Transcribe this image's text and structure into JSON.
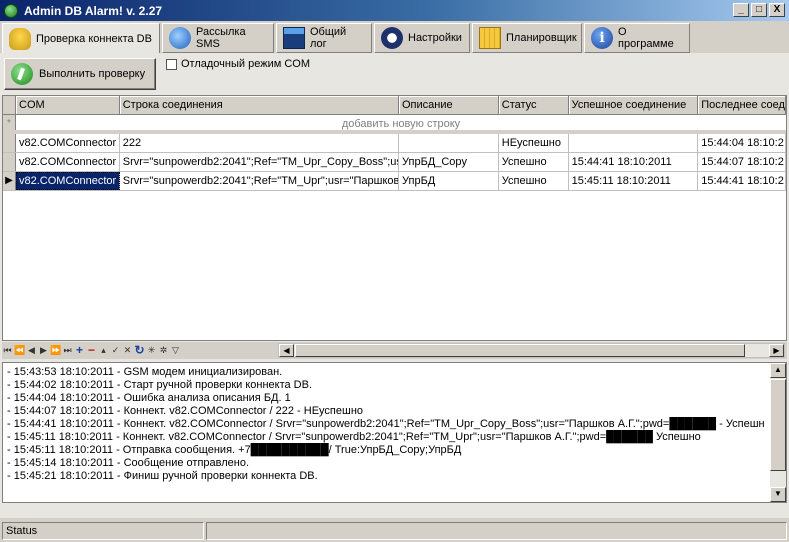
{
  "window": {
    "title": "Admin DB Alarm! v. 2.27",
    "buttons": [
      "_",
      "□",
      "X"
    ]
  },
  "tabs": [
    {
      "label": "Проверка коннекта DB",
      "icon": "bell-icon",
      "active": true
    },
    {
      "label": "Рассылка SMS",
      "icon": "globe-icon",
      "active": false
    },
    {
      "label": "Общий лог",
      "icon": "log-icon",
      "active": false
    },
    {
      "label": "Настройки",
      "icon": "settings-icon",
      "active": false
    },
    {
      "label": "Планировщик",
      "icon": "calendar-icon",
      "active": false
    },
    {
      "label": "О программе",
      "icon": "info-icon",
      "active": false
    }
  ],
  "toolbar": {
    "run_label": "Выполнить проверку",
    "debug_label": "Отладочный режим COM",
    "debug_checked": false
  },
  "grid": {
    "columns": [
      "COM",
      "Строка соединения",
      "Описание",
      "Статус",
      "Успешное соединение",
      "Последнее соед"
    ],
    "new_row_label": "добавить новую строку",
    "rows": [
      [
        "v82.COMConnector",
        "222",
        "",
        "НЕуспешно",
        "",
        "15:44:04 18:10:2"
      ],
      [
        "v82.COMConnector",
        "Srvr=\"sunpowerdb2:2041\";Ref=\"TM_Upr_Copy_Boss\";usr",
        "УпрБД_Copy",
        "Успешно",
        "15:44:41 18:10:2011",
        "15:44:07 18:10:2"
      ],
      [
        "v82.COMConnector",
        "Srvr=\"sunpowerdb2:2041\";Ref=\"TM_Upr\";usr=\"Паршков",
        "УпрБД",
        "Успешно",
        "15:45:11 18:10:2011",
        "15:44:41 18:10:2"
      ]
    ]
  },
  "log": [
    "- 15:43:53 18:10:2011 - GSM модем инициализирован.",
    "- 15:44:02 18:10:2011 - Старт ручной проверки коннекта DB.",
    "- 15:44:04 18:10:2011 - Ошибка анализа описания БД. 1",
    "- 15:44:07 18:10:2011 - Коннект. v82.COMConnector / 222 - НЕуспешно",
    "- 15:44:41 18:10:2011 - Коннект. v82.COMConnector / Srvr=\"sunpowerdb2:2041\";Ref=\"TM_Upr_Copy_Boss\";usr=\"Паршков А.Г.\";pwd=██████ - Успешн",
    "- 15:45:11 18:10:2011 - Коннект. v82.COMConnector / Srvr=\"sunpowerdb2:2041\";Ref=\"TM_Upr\";usr=\"Паршков А.Г.\";pwd=██████ Успешно",
    "- 15:45:11 18:10:2011 - Отправка сообщения. +7██████████/ True:УпрБД_Copy;УпрБД",
    "- 15:45:14 18:10:2011 - Сообщение отправлено.",
    "- 15:45:21 18:10:2011 - Финиш ручной проверки коннекта DB."
  ],
  "status": {
    "label": "Status",
    "detail": ""
  }
}
